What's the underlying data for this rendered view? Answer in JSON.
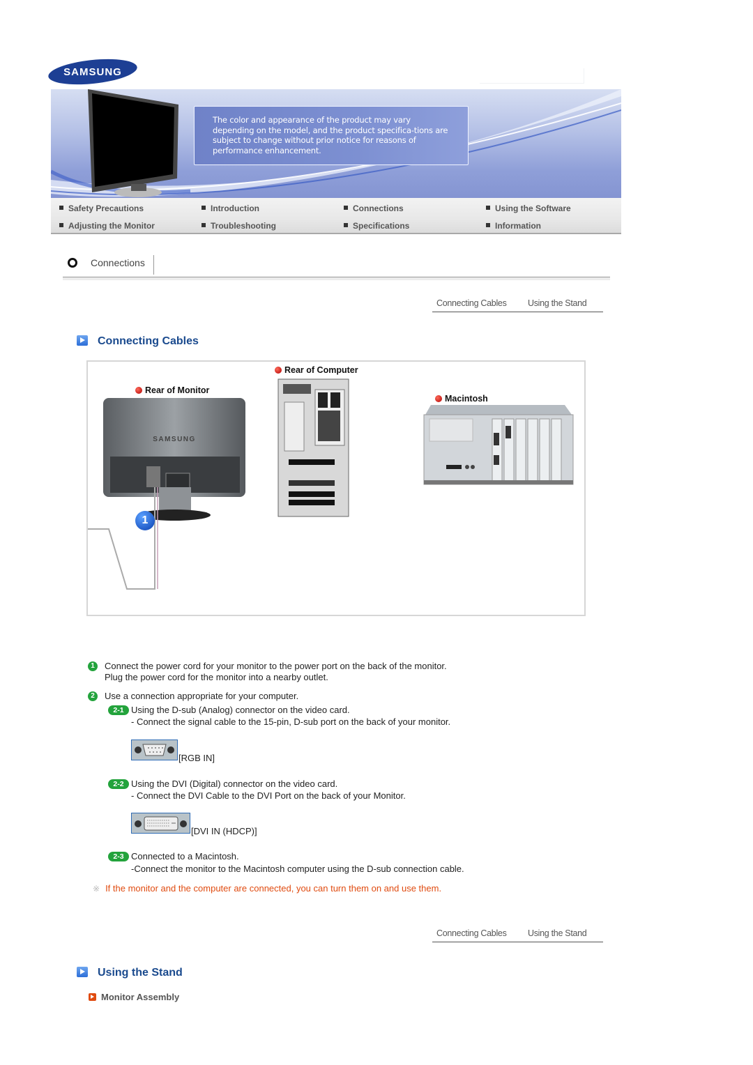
{
  "brand": {
    "logo_text": "SAMSUNG",
    "logo_color": "#1d3f94"
  },
  "banner": {
    "note": "The color and appearance of the product may vary depending on the model, and the product specifica-tions are subject to change without prior notice for reasons of performance enhancement."
  },
  "nav": {
    "items": [
      {
        "label": "Safety Precautions"
      },
      {
        "label": "Introduction"
      },
      {
        "label": "Connections"
      },
      {
        "label": "Using the Software"
      },
      {
        "label": "Adjusting the Monitor"
      },
      {
        "label": "Troubleshooting"
      },
      {
        "label": "Specifications"
      },
      {
        "label": "Information"
      }
    ]
  },
  "section": {
    "title": "Connections"
  },
  "subnav": {
    "items": [
      {
        "label": "Connecting Cables"
      },
      {
        "label": "Using the Stand"
      }
    ]
  },
  "connecting_cables": {
    "heading": "Connecting Cables",
    "diagram": {
      "labels": {
        "rear_monitor": "Rear of Monitor",
        "rear_computer": "Rear of Computer",
        "macintosh": "Macintosh"
      },
      "monitor_brand": "SAMSUNG",
      "callout": "1"
    },
    "steps": [
      {
        "num": "1",
        "lines": [
          "Connect the power cord for your monitor to the power port on the back of the monitor.",
          "Plug the power cord for the monitor into a nearby outlet."
        ]
      },
      {
        "num": "2",
        "lines": [
          "Use a connection appropriate for your computer."
        ]
      }
    ],
    "substeps": [
      {
        "badge": "2-1",
        "title": "Using the D-sub (Analog) connector on the video card.",
        "detail": "- Connect the signal cable to the 15-pin, D-sub port on the back of your monitor.",
        "port_label": "[RGB IN]",
        "port_icon": "vga-port-icon"
      },
      {
        "badge": "2-2",
        "title": "Using the DVI (Digital) connector on the video card.",
        "detail": "- Connect the DVI Cable to the DVI Port on the back of your Monitor.",
        "port_label": "[DVI IN (HDCP)]",
        "port_icon": "dvi-port-icon"
      },
      {
        "badge": "2-3",
        "title": "Connected to a Macintosh.",
        "detail": "-Connect the monitor to the Macintosh computer using the D-sub connection cable."
      }
    ],
    "note_mark": "※",
    "note": "If the monitor and the computer are connected, you can turn them on and use them.",
    "note_color": "#e04b10"
  },
  "using_the_stand": {
    "heading": "Using the Stand",
    "subheading": "Monitor Assembly"
  }
}
